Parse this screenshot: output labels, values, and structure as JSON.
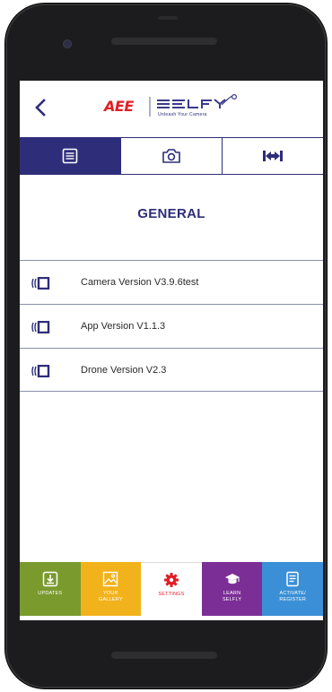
{
  "header": {
    "back_icon": "chevron-left-icon",
    "brand_name": "AEE",
    "product_name": "SELFLY",
    "tagline": "Unleash Your Camera"
  },
  "tabs": [
    {
      "icon": "list-icon",
      "active": true
    },
    {
      "icon": "camera-icon",
      "active": false
    },
    {
      "icon": "drone-icon",
      "active": false
    }
  ],
  "section": {
    "title": "GENERAL"
  },
  "info_rows": [
    {
      "icon": "device-version-icon",
      "label": "Camera Version V3.9.6test"
    },
    {
      "icon": "device-version-icon",
      "label": "App Version V1.1.3"
    },
    {
      "icon": "device-version-icon",
      "label": "Drone Version V2.3"
    }
  ],
  "bottom_nav": [
    {
      "label": "UPDATES",
      "icon": "download-icon",
      "color": "#7a9a2e",
      "active": false
    },
    {
      "label": "YOUR\nGALLERY",
      "icon": "image-icon",
      "color": "#f2b21b",
      "active": false
    },
    {
      "label": "SETTINGS",
      "icon": "gear-icon",
      "color": "#ffffff",
      "active": true
    },
    {
      "label": "LEARN\nSELFLY",
      "icon": "graduation-cap-icon",
      "color": "#7b2f96",
      "active": false
    },
    {
      "label": "ACTIVATE/\nREGISTER",
      "icon": "register-icon",
      "color": "#3b8fd6",
      "active": false
    }
  ],
  "colors": {
    "primary": "#2e2d7a",
    "accent_red": "#e21d24",
    "divider": "#8a8fa8"
  }
}
